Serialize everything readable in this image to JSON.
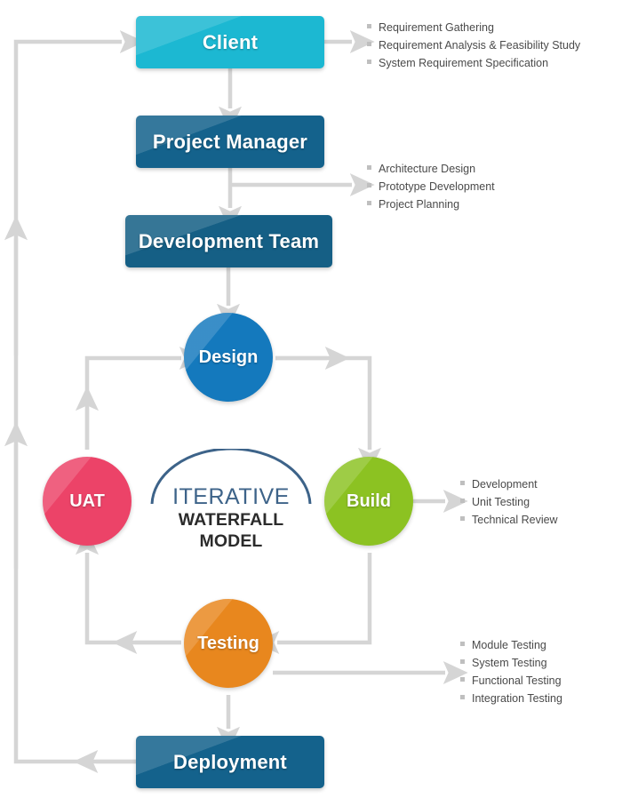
{
  "diagram": {
    "title": "Iterative Waterfall Model",
    "center_logo": {
      "line1": "ITERATIVE",
      "line2": "WATERFALL MODEL",
      "arc_color": "#3d6389",
      "line1_color": "#3d6389",
      "line2_color": "#2b2b2b"
    },
    "connector_color": "#d5d5d5"
  },
  "nodes": {
    "client": {
      "label": "Client",
      "shape": "rounded-rect",
      "color": "#1cb8d2"
    },
    "pm": {
      "label": "Project Manager",
      "shape": "rounded-rect",
      "color": "#14628c"
    },
    "dev_team": {
      "label": "Development Team",
      "shape": "rounded-rect",
      "color": "#155f85"
    },
    "deployment": {
      "label": "Deployment",
      "shape": "rounded-rect",
      "color": "#14628c"
    },
    "design": {
      "label": "Design",
      "shape": "circle",
      "color": "#1479bd"
    },
    "uat": {
      "label": "UAT",
      "shape": "circle",
      "color": "#ec4368"
    },
    "build": {
      "label": "Build",
      "shape": "circle",
      "color": "#8cc222"
    },
    "testing": {
      "label": "Testing",
      "shape": "circle",
      "color": "#e8871e"
    }
  },
  "lists": {
    "client": {
      "items": [
        "Requirement Gathering",
        "Requirement Analysis & Feasibility Study",
        "System Requirement Specification"
      ]
    },
    "pm": {
      "items": [
        "Architecture Design",
        "Prototype Development",
        "Project Planning"
      ]
    },
    "build": {
      "items": [
        "Development",
        "Unit Testing",
        "Technical Review"
      ]
    },
    "testing": {
      "items": [
        "Module Testing",
        "System Testing",
        "Functional Testing",
        "Integration Testing"
      ]
    }
  }
}
